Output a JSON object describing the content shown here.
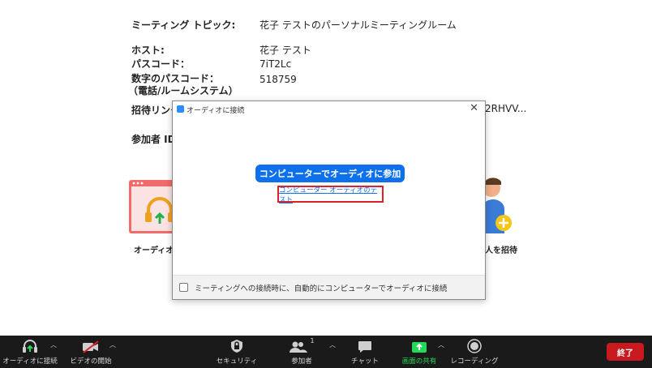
{
  "meeting": {
    "topic_label": "ミーティング トピック:",
    "topic_value": "花子 テストのパーソナルミーティングルーム",
    "host_label": "ホスト:",
    "host_value": "花子 テスト",
    "passcode_label": "パスコード：",
    "passcode_value": "7iT2Lc",
    "numeric_passcode_label": "数字のパスコード：",
    "numeric_passcode_sub": "（電話/ルームシステム）",
    "numeric_passcode_value": "518759",
    "invite_link_label": "招待リンク",
    "invite_link_value": "2RHVV...",
    "participant_id_label": "参加者 ID"
  },
  "tiles": {
    "audio_caption": "オーディオに",
    "invite_caption": "人を招待"
  },
  "dialog": {
    "title": "オーディオに接続",
    "close": "✕",
    "join_button": "コンピューターでオーディオに参加",
    "test_link": "コンピューター オーディオのテスト",
    "auto_connect_label": "ミーティングへの接続時に、自動的にコンピューターでオーディオに接続"
  },
  "toolbar": {
    "audio": "オーディオに接続",
    "video": "ビデオの開始",
    "security": "セキュリティ",
    "participants": "参加者",
    "participants_count": "1",
    "chat": "チャット",
    "share": "画面の共有",
    "record": "レコーディング",
    "end": "終了"
  },
  "colors": {
    "primary_blue": "#0e71eb",
    "share_green": "#23d959",
    "end_red": "#c8191f",
    "highlight_red": "#e0212b"
  }
}
